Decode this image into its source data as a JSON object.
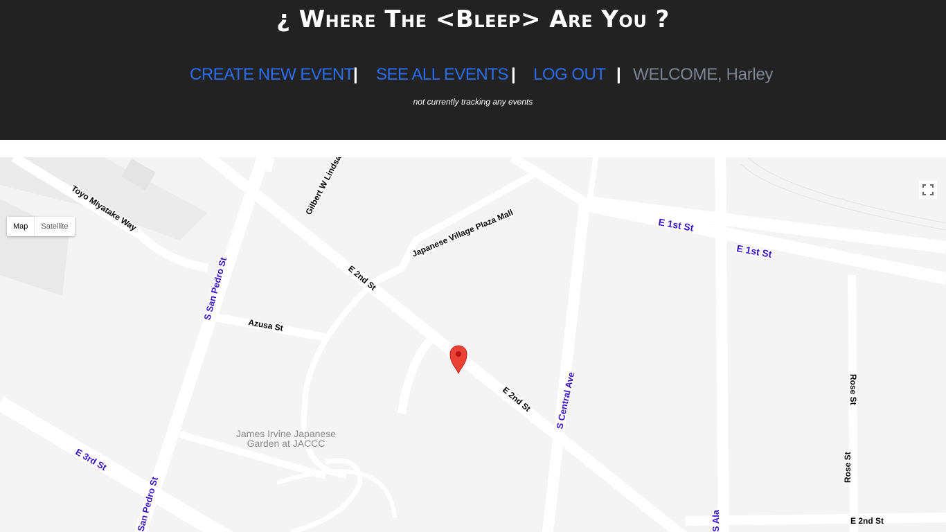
{
  "header": {
    "title": "¿ Where The <Bleep> Are You ?",
    "nav": {
      "create": "CREATE NEW EVENT",
      "see_all": "SEE ALL EVENTS",
      "logout": "LOG OUT",
      "separator": "|",
      "welcome": "WELCOME, Harley"
    },
    "status": "not currently tracking any events"
  },
  "map": {
    "map_type": {
      "map": "Map",
      "satellite": "Satellite",
      "selected": "Map"
    },
    "place_label": [
      "James Irvine Japanese",
      "Garden at JACCC"
    ],
    "street_labels": [
      "Toyo Miyatake Way",
      "Gilbert W Lindsay",
      "Japanese Village Plaza Mall",
      "E 1st St",
      "E 1st St",
      "E 2nd St",
      "E 2nd St",
      "S San Pedro St",
      "Azusa St",
      "S Central Ave",
      "Rose St",
      "Rose St",
      "E 3rd St",
      "San Pedro St",
      "E 2nd St",
      "S Ala"
    ],
    "marker_icon": "map-pin-icon",
    "fullscreen_icon": "fullscreen-icon",
    "colors": {
      "marker": "#ea4335",
      "street_label": "#1a0dab",
      "road": "#ffffff",
      "land": "#f4f4f4"
    }
  }
}
